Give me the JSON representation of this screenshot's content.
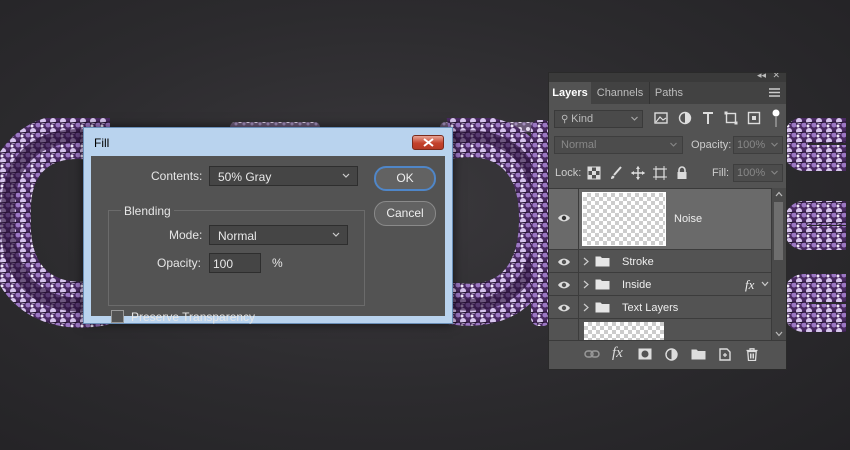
{
  "dialog": {
    "title": "Fill",
    "contents_label": "Contents:",
    "contents_value": "50% Gray",
    "blending_label": "Blending",
    "mode_label": "Mode:",
    "mode_value": "Normal",
    "opacity_label": "Opacity:",
    "opacity_value": "100",
    "opacity_unit": "%",
    "preserve_label": "Preserve Transparency",
    "preserve_checked": false,
    "ok_label": "OK",
    "cancel_label": "Cancel"
  },
  "layers_panel": {
    "tabs": [
      {
        "label": "Layers",
        "active": true
      },
      {
        "label": "Channels",
        "active": false
      },
      {
        "label": "Paths",
        "active": false
      }
    ],
    "filter_placeholder": "Kind",
    "filter_icons": [
      "image-filter-icon",
      "adjustment-filter-icon",
      "type-filter-icon",
      "shape-filter-icon",
      "smart-object-filter-icon"
    ],
    "blend_mode": "Normal",
    "opacity_label": "Opacity:",
    "opacity_value": "100%",
    "lock_label": "Lock:",
    "lock_icons": [
      "lock-transparent-pixels-icon",
      "lock-image-pixels-icon",
      "lock-position-icon",
      "lock-artboard-icon",
      "lock-all-icon"
    ],
    "fill_label": "Fill:",
    "fill_value": "100%",
    "layers": [
      {
        "name": "Noise",
        "type": "pixel",
        "visible": true,
        "selected": true
      },
      {
        "name": "Stroke",
        "type": "group",
        "visible": true,
        "fx": false
      },
      {
        "name": "Inside",
        "type": "group",
        "visible": true,
        "fx": true
      },
      {
        "name": "Text Layers",
        "type": "group",
        "visible": true,
        "fx": false
      },
      {
        "name": "",
        "type": "pixel",
        "visible": false
      }
    ],
    "fx_symbol": "fx",
    "footer_icons": [
      "link-layers-icon",
      "add-layer-style-icon",
      "add-layer-mask-icon",
      "new-adjustment-layer-icon",
      "new-group-icon",
      "new-layer-icon",
      "delete-layer-icon"
    ]
  },
  "colors": {
    "dialog_chrome": "#b9d3ee",
    "dialog_body": "#535353",
    "ok_focus": "#4f86c8",
    "close_button": "#c4422c",
    "glitter_purple": "#b79ad6"
  }
}
